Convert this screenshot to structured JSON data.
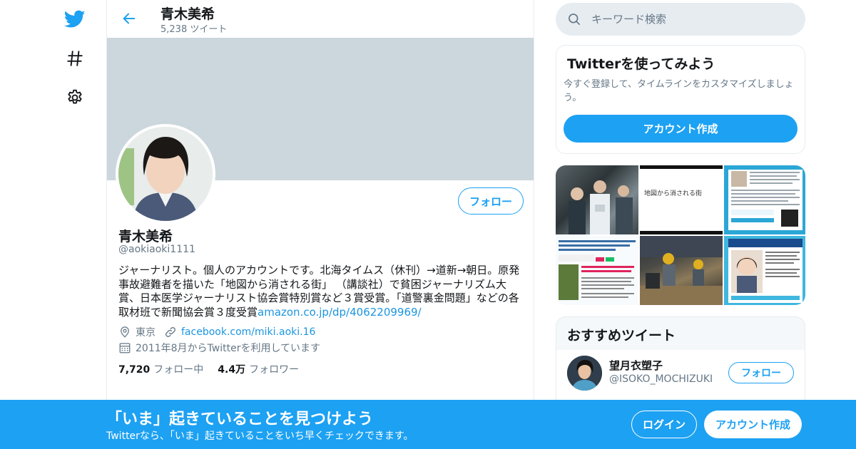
{
  "nav": {
    "icons": [
      "twitter-logo-icon",
      "hashtag-icon",
      "gear-icon"
    ]
  },
  "header": {
    "name": "青木美希",
    "tweet_count": "5,238 ツイート"
  },
  "profile": {
    "follow_label": "フォロー",
    "name": "青木美希",
    "handle": "@aokiaoki1111",
    "bio": "ジャーナリスト。個人のアカウントです。北海タイムス（休刊）→道新→朝日。原発事故避難者を描いた「地図から消される街」 （講談社）で貧困ジャーナリズム大賞、日本医学ジャーナリスト協会賞特別賞など３賞受賞。「道警裏金問題」などの各取材班で新聞協会賞３度受賞",
    "bio_link": "amazon.co.jp/dp/4062209969/",
    "location": "東京",
    "website": "facebook.com/miki.aoki.16",
    "joined": "2011年8月からTwitterを利用しています",
    "following_count": "7,720",
    "following_label": "フォロー中",
    "followers_count": "4.4万",
    "followers_label": "フォロワー"
  },
  "search": {
    "placeholder": "キーワード検索"
  },
  "signup_card": {
    "title": "Twitterを使ってみよう",
    "description": "今すぐ登録して、タイムラインをカスタマイズしましょう。",
    "button": "アカウント作成"
  },
  "media": {
    "thumb2_text": "地図から消される街"
  },
  "recommended": {
    "title": "おすすめツイート",
    "user_name": "望月衣塑子",
    "user_handle": "@ISOKO_MOCHIZUKI",
    "follow_label": "フォロー"
  },
  "bottom_banner": {
    "title": "「いま」起きていることを見つけよう",
    "subtitle": "Twitterなら、「いま」起きていることをいち早くチェックできます。",
    "login": "ログイン",
    "signup": "アカウント作成"
  },
  "colors": {
    "accent": "#1da1f2",
    "link": "#1b95e0",
    "banner_gray": "#ccd6dd",
    "muted_text": "#657786"
  }
}
